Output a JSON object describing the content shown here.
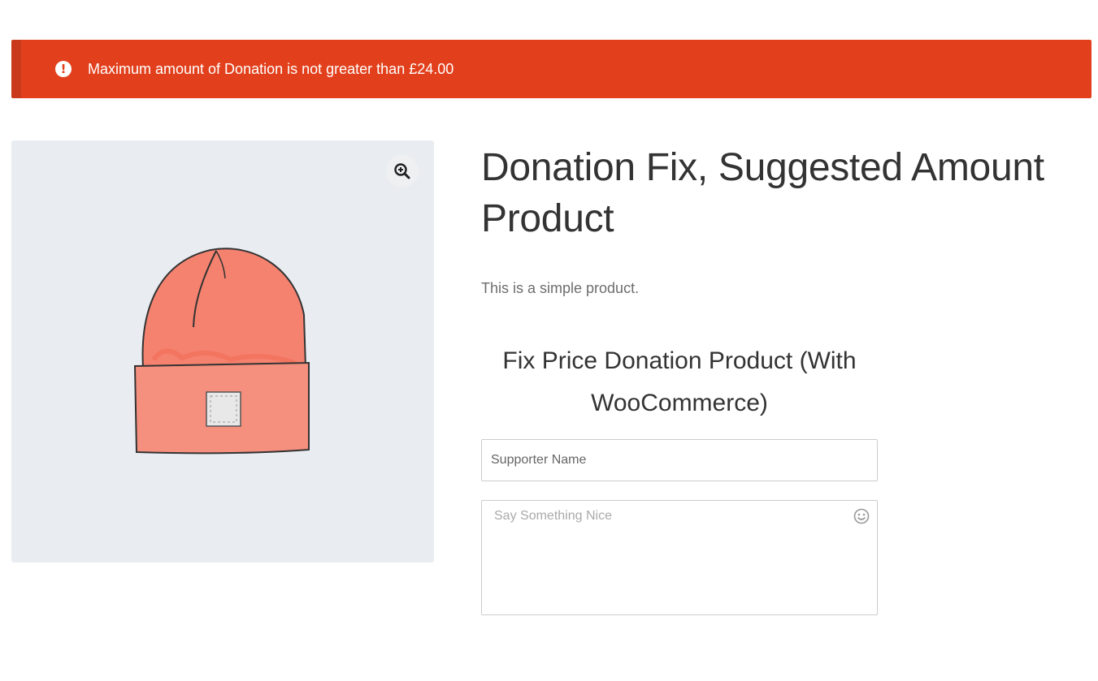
{
  "notice": {
    "message": "Maximum amount of Donation is not greater than £24.00",
    "icon": "alert-circle-icon",
    "color": "#e2401c"
  },
  "product": {
    "title": "Donation Fix, Suggested Amount Product",
    "short_description": "This is a simple product.",
    "image_icon": "beanie-hat-image",
    "zoom_icon": "zoom-in-icon"
  },
  "donation_form": {
    "title": "Fix Price Donation Product (With WooCommerce)",
    "supporter_name_placeholder": "Supporter Name",
    "message_placeholder": "Say Something Nice",
    "emoji_icon": "smiley-icon"
  }
}
